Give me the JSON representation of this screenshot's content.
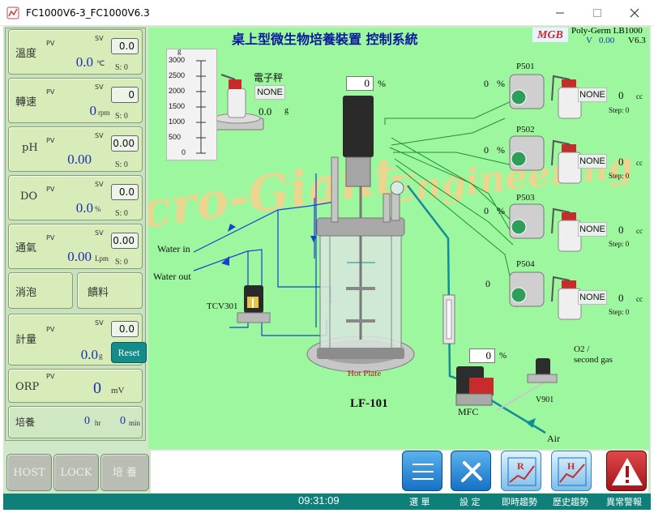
{
  "window": {
    "title": "FC1000V6-3_FC1000V6.3"
  },
  "left_panel": {
    "temp": {
      "label": "溫度",
      "pv_label": "PV",
      "sv_label": "SV",
      "pv": "0.0",
      "unit": "℃",
      "sv": "0.0",
      "step": "S: 0"
    },
    "speed": {
      "label": "轉速",
      "pv_label": "PV",
      "sv_label": "SV",
      "pv": "0",
      "unit": "rpm",
      "sv": "0",
      "step": "S: 0"
    },
    "ph": {
      "label": "pH",
      "pv_label": "PV",
      "sv_label": "SV",
      "pv": "0.00",
      "unit": "",
      "sv": "0.00",
      "step": "S: 0"
    },
    "do": {
      "label": "DO",
      "pv_label": "PV",
      "sv_label": "SV",
      "pv": "0.0",
      "unit": "%",
      "sv": "0.0",
      "step": "S: 0"
    },
    "aeration": {
      "label": "通氣",
      "pv_label": "PV",
      "sv_label": "SV",
      "pv": "0.00",
      "unit": "Lpm",
      "sv": "0.00",
      "step": "S: 0"
    },
    "antifoam": {
      "label": "消泡"
    },
    "feed": {
      "label": "饋料"
    },
    "metering": {
      "label": "計量",
      "pv_label": "PV",
      "sv_label": "SV",
      "pv": "0.0",
      "unit": "g",
      "sv": "0.0",
      "reset": "Reset"
    },
    "orp": {
      "label": "ORP",
      "pv_label": "PV",
      "pv": "0",
      "unit": "mV"
    },
    "culture": {
      "label": "培養",
      "hours": "0",
      "hours_unit": "hr",
      "minutes": "0",
      "minutes_unit": "min"
    }
  },
  "header": {
    "title": "桌上型微生物培養裝置 控制系統",
    "logo_text": "MGB",
    "brand": "Poly-Germ LB1000",
    "v_label": "V",
    "v_value": "0.00",
    "version": "V6.3"
  },
  "watermark": {
    "left": "cro-Giant",
    "right": "Engineering"
  },
  "scale": {
    "unit": "g",
    "ticks": [
      "3000",
      "2500",
      "2000",
      "1500",
      "1000",
      "500",
      "0"
    ]
  },
  "balance": {
    "label": "電子秤",
    "status": "NONE",
    "value": "0.0",
    "unit": "g"
  },
  "motor": {
    "value": "0",
    "unit": "%"
  },
  "reactor": {
    "water_in": "Water in",
    "water_out": "Water out",
    "tcv": "TCV301",
    "hotplate": "Hot Plate",
    "name": "LF-101"
  },
  "pumps": [
    {
      "label": "P501",
      "value": "0",
      "unit": "%",
      "status": "NONE",
      "cc_value": "0",
      "cc_unit": "cc",
      "step": "Step: 0"
    },
    {
      "label": "P502",
      "value": "0",
      "unit": "%",
      "status": "NONE",
      "cc_value": "0",
      "cc_unit": "cc",
      "step": "Step: 0"
    },
    {
      "label": "P503",
      "value": "0",
      "unit": "%",
      "status": "NONE",
      "cc_value": "0",
      "cc_unit": "cc",
      "step": "Step: 0"
    },
    {
      "label": "P504",
      "value": "0",
      "unit": "%",
      "status": "NONE",
      "cc_value": "0",
      "cc_unit": "cc",
      "step": "Step: 0"
    }
  ],
  "mfc": {
    "label": "MFC",
    "value": "0",
    "unit": "%"
  },
  "gas": {
    "o2_label": "O2 /",
    "second_gas": "second gas",
    "valve": "V901",
    "air": "Air"
  },
  "bottom": {
    "modes": [
      "HOST",
      "LOCK",
      "培 養"
    ],
    "clock": "09:31:09",
    "nav": [
      "選 單",
      "設 定",
      "即時趨勢",
      "歷史趨勢",
      "異常警報"
    ],
    "nav_icon_letters": {
      "realtime": "R",
      "history": "H"
    }
  },
  "colors": {
    "canvas_bg": "#9cf79e",
    "panel_bg": "#c6e3bd",
    "value_blue": "#1f2fb0",
    "status_teal": "#0f7f7a",
    "line_green": "#1f8f3a",
    "line_blue": "#1c3fcf",
    "line_teal": "#0f8f95"
  }
}
